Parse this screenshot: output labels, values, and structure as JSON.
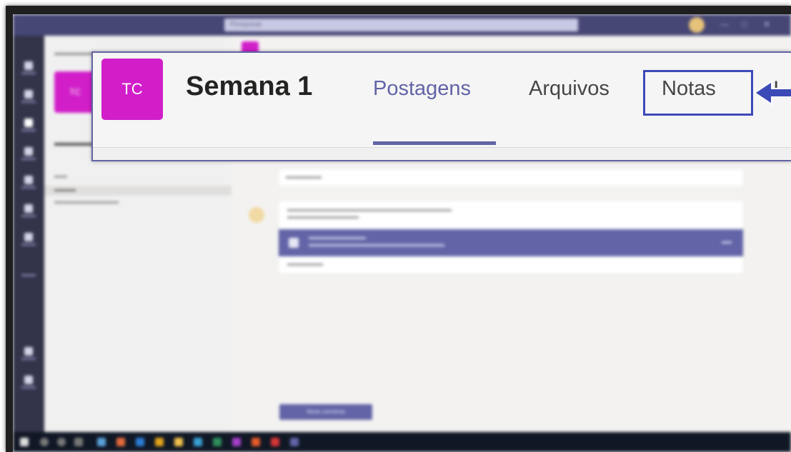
{
  "window": {
    "search_placeholder": "Pesquisar"
  },
  "left_panel": {
    "team_initials": "TC"
  },
  "content": {
    "new_conversation_label": "Nova conversa"
  },
  "callout": {
    "team_initials": "TC",
    "channel_name": "Semana 1",
    "tabs": [
      {
        "label": "Postagens",
        "active": true
      },
      {
        "label": "Arquivos",
        "active": false
      },
      {
        "label": "Notas",
        "active": false,
        "highlighted": true
      },
      {
        "label": "I",
        "active": false
      }
    ]
  },
  "colors": {
    "accent": "#6264a7",
    "team_avatar": "#d11ec9",
    "highlight": "#3c4ab8",
    "titlebar": "#464775",
    "rail": "#33344a"
  },
  "icons": {
    "arrow": "arrow-left-icon"
  }
}
